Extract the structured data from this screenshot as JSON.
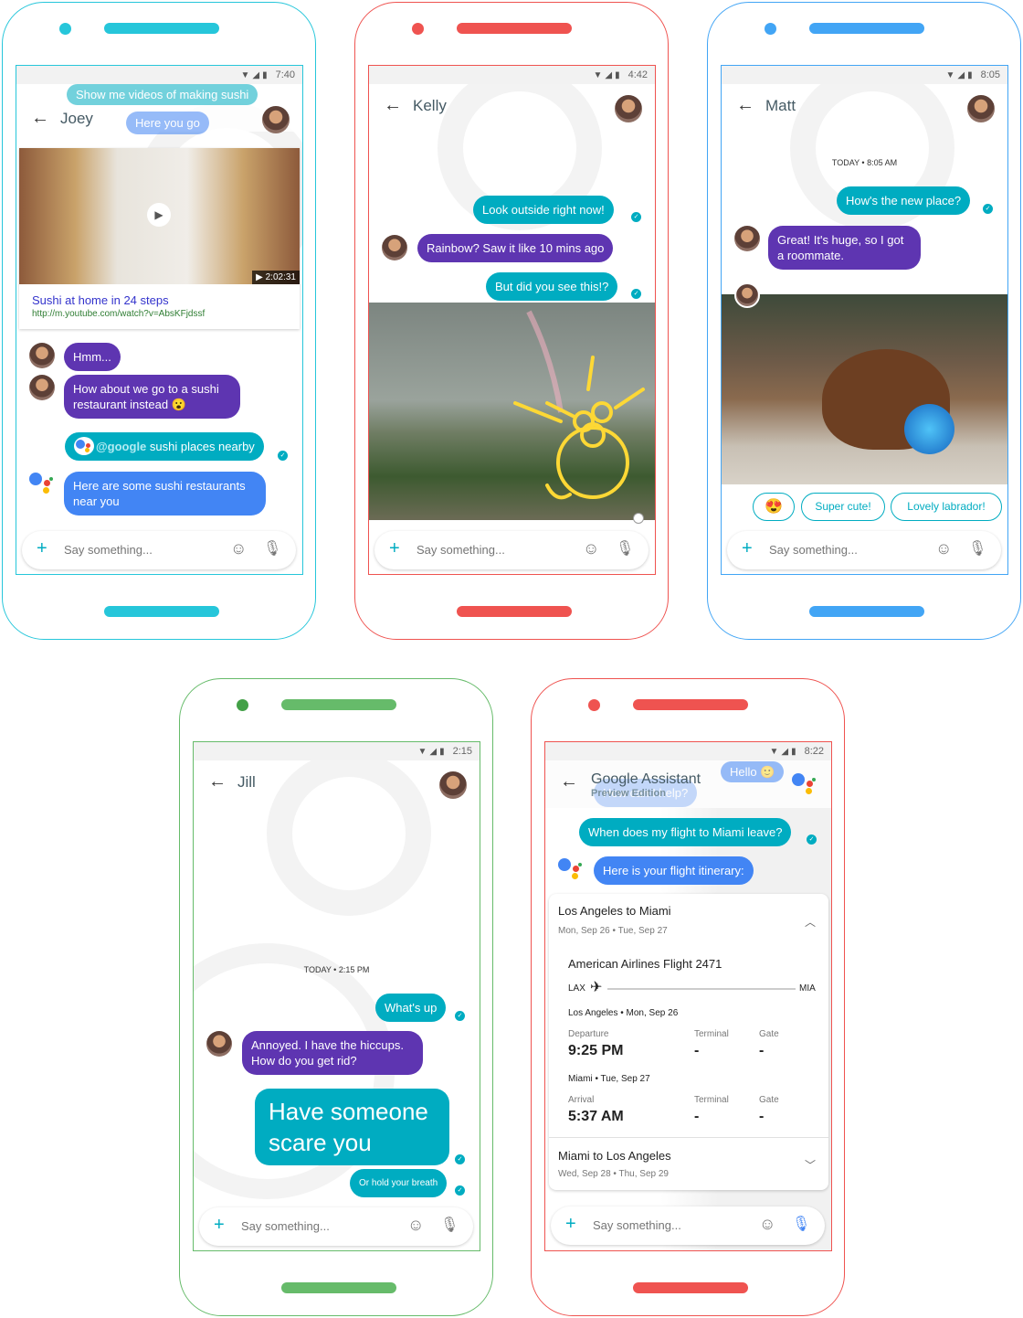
{
  "colors": {
    "cyan": "#26c6da",
    "red": "#ef5350",
    "blue": "#42a5f5",
    "green": "#66bb6a",
    "teal_bubble": "#00acc1",
    "purple_bubble": "#5e35b1",
    "assistant_bubble": "#4285f4"
  },
  "common": {
    "input_placeholder": "Say something...",
    "icons": [
      "back-arrow-icon",
      "plus-icon",
      "emoji-icon",
      "mic-icon",
      "wifi-icon",
      "signal-icon",
      "battery-icon",
      "read-check-icon"
    ]
  },
  "phone1": {
    "time": "7:40",
    "contact": "Joey",
    "ghost_user": "Show me videos of making sushi",
    "ghost_assistant": "Here you go",
    "video": {
      "duration": "2:02:31",
      "title": "Sushi at home in 24 steps",
      "url": "http://m.youtube.com/watch?v=AbsKFjdssf"
    },
    "messages": [
      {
        "from": "Joey",
        "text": "Hmm..."
      },
      {
        "from": "Joey",
        "text": "How about we go to a sushi restaurant instead 😮"
      },
      {
        "from": "me",
        "mention": "@google",
        "text": " sushi places nearby"
      },
      {
        "from": "assistant",
        "text": "Here are some sushi restaurants near you"
      }
    ]
  },
  "phone2": {
    "time": "4:42",
    "contact": "Kelly",
    "messages": [
      {
        "from": "me",
        "text": "Look outside right now!"
      },
      {
        "from": "Kelly",
        "text": "Rainbow? Saw it like 10 mins ago"
      },
      {
        "from": "me",
        "text": "But did you see this!?"
      }
    ]
  },
  "phone3": {
    "time": "8:05",
    "contact": "Matt",
    "timestamp": "TODAY • 8:05 AM",
    "messages": [
      {
        "from": "me",
        "text": "How's the new place?"
      },
      {
        "from": "Matt",
        "text": "Great! It's huge, so I got a roommate."
      }
    ],
    "smart_replies": [
      "😍",
      "Super cute!",
      "Lovely labrador!"
    ]
  },
  "phone4": {
    "time": "2:15",
    "contact": "Jill",
    "timestamp": "TODAY • 2:15 PM",
    "messages": [
      {
        "from": "me",
        "text": "What's up"
      },
      {
        "from": "Jill",
        "text": "Annoyed. I have the hiccups. How do you get rid?"
      },
      {
        "from": "me",
        "text": "Have someone scare you"
      },
      {
        "from": "me",
        "text": "Or hold your breath"
      }
    ]
  },
  "phone5": {
    "time": "8:22",
    "title": "Google Assistant",
    "subtitle": "Preview Edition",
    "ghost_1": "Hello 🙂",
    "ghost_2": "How can I help?",
    "messages": [
      {
        "from": "me",
        "text": "When does my flight to Miami leave?"
      },
      {
        "from": "assistant",
        "text": "Here is your flight itinerary:"
      }
    ],
    "itinerary": {
      "outbound": {
        "route": "Los Angeles to Miami",
        "dates": "Mon, Sep 26 • Tue, Sep 27",
        "flight": "American Airlines Flight 2471",
        "from": "LAX",
        "to": "MIA",
        "dep_place": "Los Angeles • Mon, Sep 26",
        "dep_label": "Departure",
        "dep_time": "9:25 PM",
        "arr_place": "Miami • Tue, Sep 27",
        "arr_label": "Arrival",
        "arr_time": "5:37 AM",
        "terminal_label": "Terminal",
        "gate_label": "Gate",
        "dep_terminal": "-",
        "dep_gate": "-",
        "arr_terminal": "-",
        "arr_gate": "-"
      },
      "return": {
        "route": "Miami to Los Angeles",
        "dates": "Wed, Sep 28 • Thu, Sep 29"
      }
    }
  }
}
